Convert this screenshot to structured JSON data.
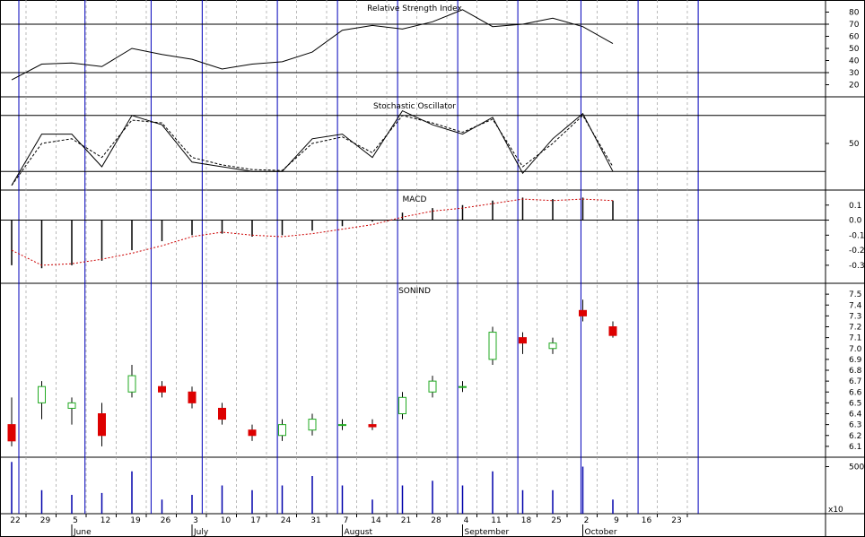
{
  "colors": {
    "axis": "#000000",
    "cycle": "#0000bb",
    "dotted": "#aaaaaa",
    "up": "#22aa22",
    "down": "#dd0000",
    "macd_signal": "#cc0000",
    "volume": "#0000aa"
  },
  "chart_data": [
    {
      "type": "line",
      "title": "Relative Strength Index",
      "ylim": [
        10,
        90
      ],
      "ticks": [
        20,
        30,
        40,
        50,
        60,
        70,
        80
      ],
      "ref_lines": [
        30,
        70
      ],
      "x": [
        "22",
        "29",
        "5",
        "12",
        "19",
        "26",
        "3",
        "10",
        "17",
        "24",
        "31",
        "7",
        "14",
        "21",
        "28",
        "4",
        "11",
        "18",
        "25",
        "2",
        "9"
      ],
      "values": [
        24,
        37,
        38,
        35,
        50,
        45,
        41,
        33,
        37,
        39,
        47,
        65,
        69,
        66,
        72,
        82,
        68,
        70,
        75,
        68,
        54
      ]
    },
    {
      "type": "line",
      "title": "Stochastic Oscillator",
      "ylim": [
        0,
        100
      ],
      "ticks": [
        50
      ],
      "ref_lines": [
        20,
        80
      ],
      "x": [
        "22",
        "29",
        "5",
        "12",
        "19",
        "26",
        "3",
        "10",
        "17",
        "24",
        "31",
        "7",
        "14",
        "21",
        "28",
        "4",
        "11",
        "18",
        "25",
        "2",
        "9"
      ],
      "series": [
        {
          "values": [
            5,
            60,
            60,
            25,
            80,
            70,
            30,
            25,
            20,
            20,
            55,
            60,
            35,
            85,
            70,
            60,
            78,
            18,
            55,
            82,
            20
          ]
        },
        {
          "values": [
            5,
            50,
            55,
            35,
            75,
            72,
            35,
            27,
            22,
            21,
            50,
            57,
            40,
            80,
            72,
            62,
            76,
            25,
            50,
            80,
            25
          ]
        }
      ]
    },
    {
      "type": "bar",
      "title": "MACD",
      "ylim": [
        -0.42,
        0.2
      ],
      "ticks": [
        0.1,
        0.0,
        -0.1,
        -0.2,
        -0.3
      ],
      "x": [
        "22",
        "29",
        "5",
        "12",
        "19",
        "26",
        "3",
        "10",
        "17",
        "24",
        "31",
        "7",
        "14",
        "21",
        "28",
        "4",
        "11",
        "18",
        "25",
        "2",
        "9"
      ],
      "values": [
        -0.3,
        -0.32,
        -0.3,
        -0.27,
        -0.2,
        -0.14,
        -0.1,
        -0.09,
        -0.11,
        -0.1,
        -0.07,
        -0.04,
        -0.01,
        0.05,
        0.08,
        0.1,
        0.13,
        0.15,
        0.14,
        0.15,
        0.13
      ],
      "signal": [
        -0.2,
        -0.3,
        -0.29,
        -0.26,
        -0.22,
        -0.17,
        -0.11,
        -0.08,
        -0.1,
        -0.11,
        -0.09,
        -0.06,
        -0.03,
        0.02,
        0.06,
        0.08,
        0.11,
        0.14,
        0.13,
        0.14,
        0.13
      ]
    },
    {
      "type": "candlestick",
      "title": "SONIND",
      "ylim": [
        6.0,
        7.6
      ],
      "ticks": [
        7.5,
        7.4,
        7.3,
        7.2,
        7.1,
        7.0,
        6.9,
        6.8,
        6.7,
        6.6,
        6.5,
        6.4,
        6.3,
        6.2,
        6.1
      ],
      "x": [
        "22",
        "29",
        "5",
        "12",
        "19",
        "26",
        "3",
        "10",
        "17",
        "24",
        "31",
        "7",
        "14",
        "21",
        "28",
        "4",
        "11",
        "18",
        "25",
        "2",
        "9"
      ],
      "candles": [
        {
          "o": 6.3,
          "h": 6.55,
          "l": 6.1,
          "c": 6.15
        },
        {
          "o": 6.5,
          "h": 6.7,
          "l": 6.35,
          "c": 6.65
        },
        {
          "o": 6.45,
          "h": 6.55,
          "l": 6.3,
          "c": 6.5
        },
        {
          "o": 6.4,
          "h": 6.5,
          "l": 6.1,
          "c": 6.2
        },
        {
          "o": 6.6,
          "h": 6.85,
          "l": 6.55,
          "c": 6.75
        },
        {
          "o": 6.65,
          "h": 6.7,
          "l": 6.55,
          "c": 6.6
        },
        {
          "o": 6.6,
          "h": 6.65,
          "l": 6.45,
          "c": 6.5
        },
        {
          "o": 6.45,
          "h": 6.5,
          "l": 6.3,
          "c": 6.35
        },
        {
          "o": 6.25,
          "h": 6.3,
          "l": 6.15,
          "c": 6.2
        },
        {
          "o": 6.2,
          "h": 6.35,
          "l": 6.15,
          "c": 6.3
        },
        {
          "o": 6.25,
          "h": 6.4,
          "l": 6.2,
          "c": 6.35
        },
        {
          "o": 6.3,
          "h": 6.35,
          "l": 6.25,
          "c": 6.3
        },
        {
          "o": 6.3,
          "h": 6.35,
          "l": 6.25,
          "c": 6.28
        },
        {
          "o": 6.4,
          "h": 6.6,
          "l": 6.35,
          "c": 6.55
        },
        {
          "o": 6.6,
          "h": 6.75,
          "l": 6.55,
          "c": 6.7
        },
        {
          "o": 6.65,
          "h": 6.7,
          "l": 6.6,
          "c": 6.65
        },
        {
          "o": 6.9,
          "h": 7.2,
          "l": 6.85,
          "c": 7.15
        },
        {
          "o": 7.1,
          "h": 7.15,
          "l": 6.95,
          "c": 7.05
        },
        {
          "o": 7.0,
          "h": 7.1,
          "l": 6.95,
          "c": 7.05
        },
        {
          "o": 7.35,
          "h": 7.45,
          "l": 7.25,
          "c": 7.3
        },
        {
          "o": 7.2,
          "h": 7.25,
          "l": 7.1,
          "c": 7.12
        }
      ]
    },
    {
      "type": "bar",
      "title": "",
      "ylim": [
        0,
        60000
      ],
      "ticks": [
        50000
      ],
      "unit_label": "x10",
      "x": [
        "22",
        "29",
        "5",
        "12",
        "19",
        "26",
        "3",
        "10",
        "17",
        "24",
        "31",
        "7",
        "14",
        "21",
        "28",
        "4",
        "11",
        "18",
        "25",
        "2",
        "9"
      ],
      "values": [
        55000,
        25000,
        20000,
        22000,
        45000,
        15000,
        20000,
        30000,
        25000,
        30000,
        40000,
        30000,
        15000,
        30000,
        35000,
        30000,
        45000,
        25000,
        25000,
        50000,
        15000
      ]
    }
  ],
  "x_axis": {
    "ticks": [
      "22",
      "29",
      "5",
      "12",
      "19",
      "26",
      "3",
      "10",
      "17",
      "24",
      "31",
      "7",
      "14",
      "21",
      "28",
      "4",
      "11",
      "18",
      "25",
      "2",
      "9",
      "16",
      "23"
    ],
    "months": [
      {
        "label": "June",
        "tick": 2
      },
      {
        "label": "July",
        "tick": 6
      },
      {
        "label": "August",
        "tick": 11
      },
      {
        "label": "September",
        "tick": 15
      },
      {
        "label": "October",
        "tick": 19
      }
    ]
  }
}
